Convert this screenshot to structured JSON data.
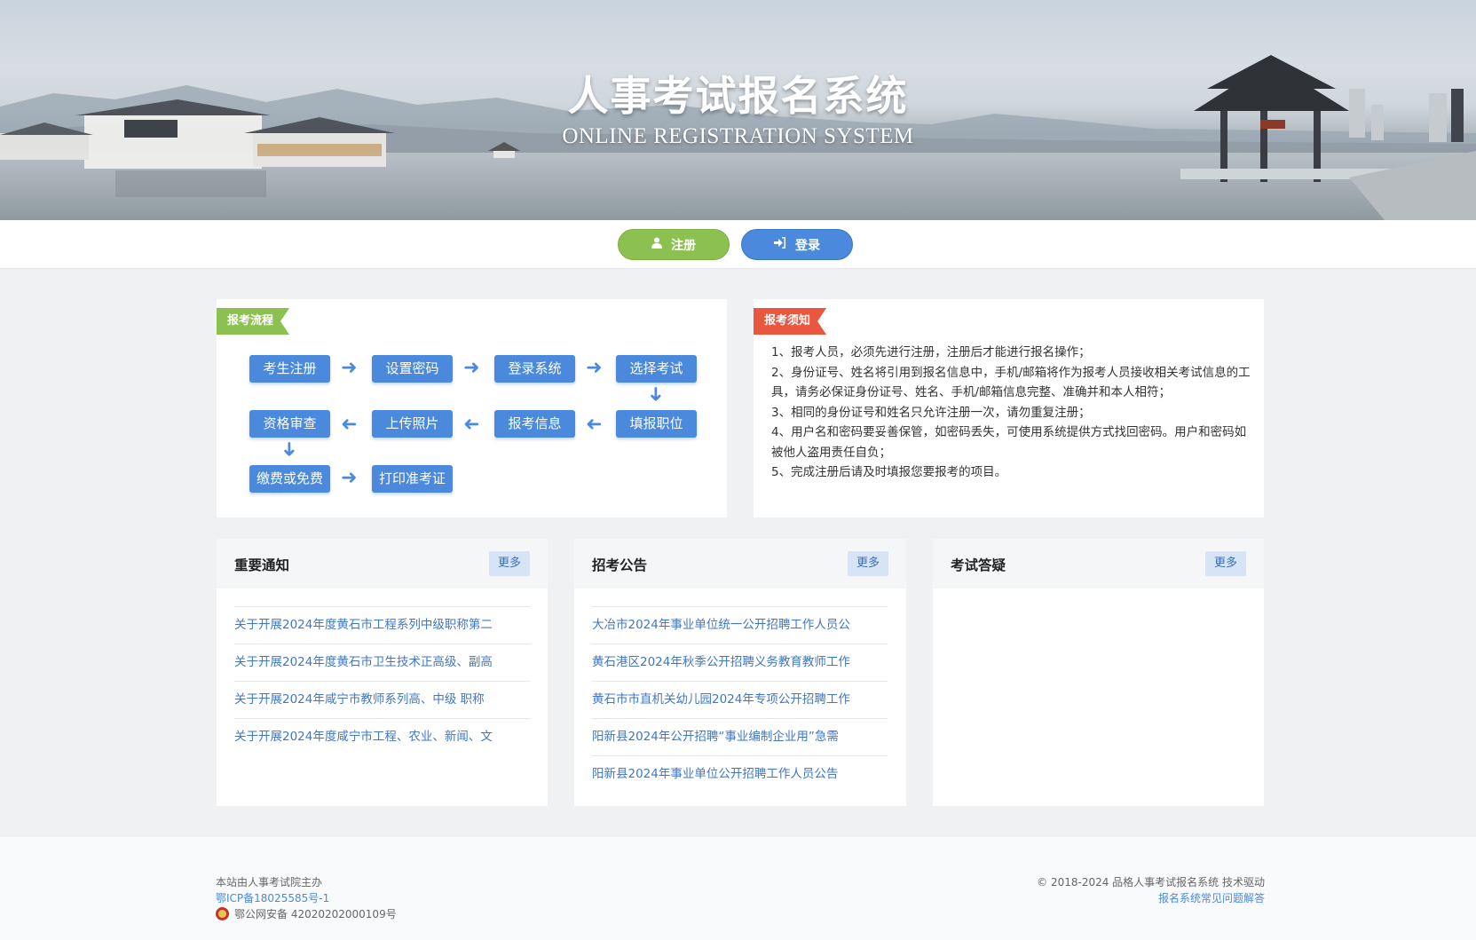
{
  "banner": {
    "title_cn": "人事考试报名系统",
    "title_en": "ONLINE REGISTRATION SYSTEM"
  },
  "nav": {
    "register_label": "注册",
    "login_label": "登录",
    "register_icon": "user-icon",
    "login_icon": "sign-in-icon"
  },
  "process": {
    "ribbon": "报考流程",
    "steps": [
      "考生注册",
      "设置密码",
      "登录系统",
      "选择考试",
      "填报职位",
      "报考信息",
      "上传照片",
      "资格审查",
      "缴费或免费",
      "打印准考证"
    ]
  },
  "notice": {
    "ribbon": "报考须知",
    "items": [
      "1、报考人员，必须先进行注册，注册后才能进行报名操作；",
      "2、身份证号、姓名将引用到报名信息中，手机/邮箱将作为报考人员接收相关考试信息的工具，请务必保证身份证号、姓名、手机/邮箱信息完整、准确并和本人相符；",
      "3、相同的身份证号和姓名只允许注册一次，请勿重复注册；",
      "4、用户名和密码要妥善保管，如密码丢失，可使用系统提供方式找回密码。用户和密码如被他人盗用责任自负；",
      "5、完成注册后请及时填报您要报考的项目。"
    ]
  },
  "boxes": [
    {
      "title": "重要通知",
      "more": "更多",
      "items": [
        "关于开展2024年度黄石市工程系列中级职称第二",
        "关于开展2024年度黄石市卫生技术正高级、副高",
        "关于开展2024年咸宁市教师系列高、中级 职称",
        "关于开展2024年度咸宁市工程、农业、新闻、文"
      ]
    },
    {
      "title": "招考公告",
      "more": "更多",
      "items": [
        "大冶市2024年事业单位统一公开招聘工作人员公",
        "黄石港区2024年秋季公开招聘义务教育教师工作",
        "黄石市市直机关幼儿园2024年专项公开招聘工作",
        "阳新县2024年公开招聘“事业编制企业用”急需",
        "阳新县2024年事业单位公开招聘工作人员公告"
      ]
    },
    {
      "title": "考试答疑",
      "more": "更多",
      "items": []
    }
  ],
  "footer": {
    "host": "本站由人事考试院主办",
    "icp": "鄂ICP备18025585号-1",
    "police": "鄂公网安备 42020202000109号",
    "copyright": "© 2018-2024 品格人事考试报名系统 技术驱动",
    "faq": "报名系统常见问题解答"
  },
  "colors": {
    "green": "#8cc152",
    "blue": "#4a89dc",
    "red": "#e9573f"
  }
}
